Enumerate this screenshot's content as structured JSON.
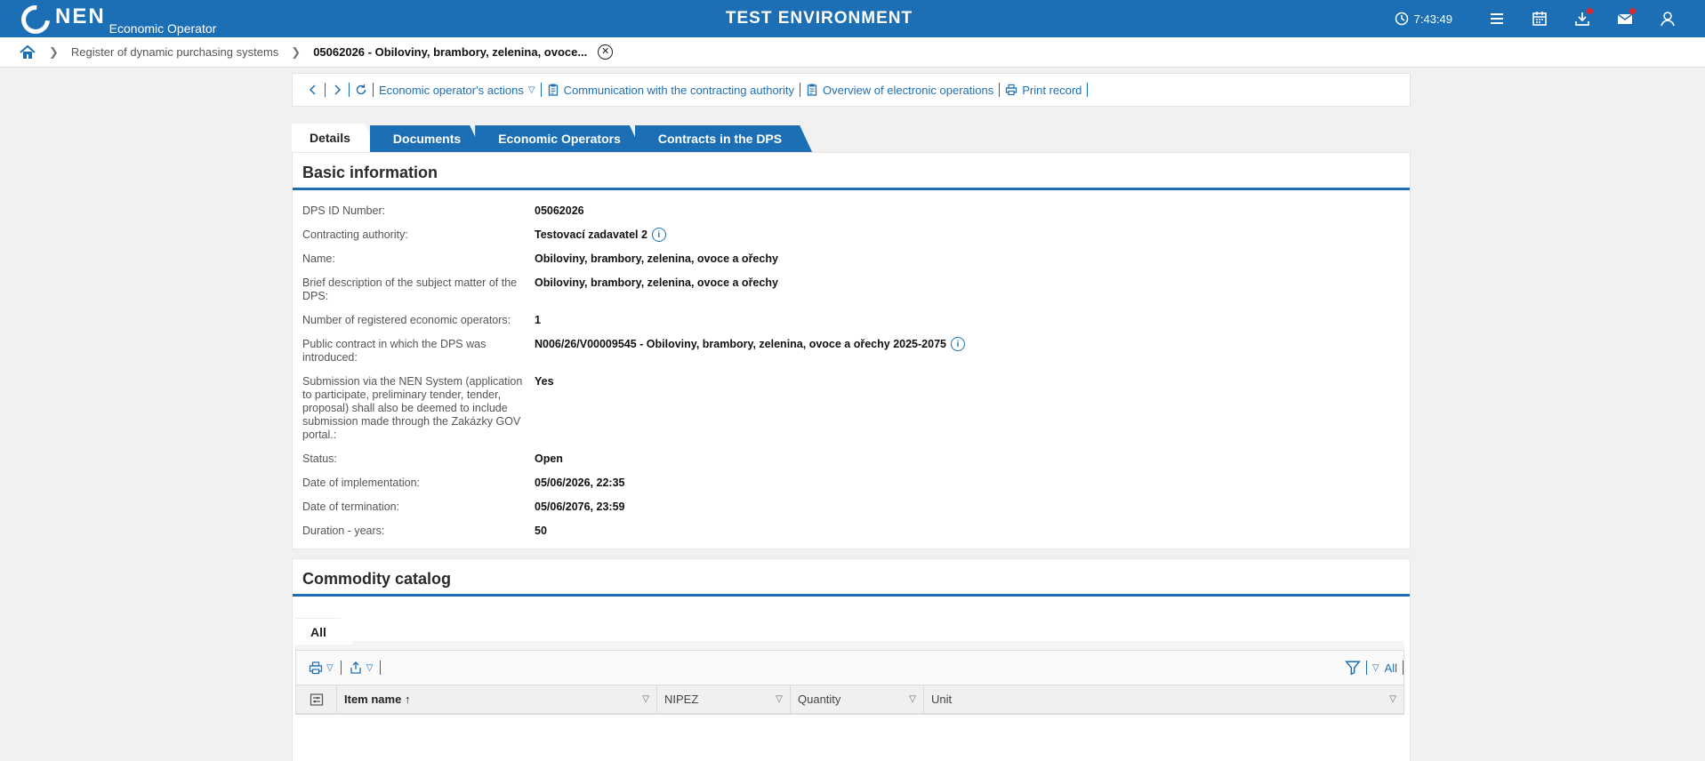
{
  "header": {
    "logo_text": "NEN",
    "logo_sub": "Economic Operator",
    "env_title": "TEST ENVIRONMENT",
    "clock": "7:43:49",
    "icons": [
      "clock-icon",
      "menu-icon",
      "calendar-icon",
      "download-icon",
      "mail-icon",
      "user-icon"
    ]
  },
  "breadcrumb": {
    "items": [
      "Register of dynamic purchasing systems"
    ],
    "current": "05062026 - Obiloviny, brambory, zelenina, ovoce..."
  },
  "toolbar": {
    "actions": "Economic operator's actions",
    "communication": "Communication with the contracting authority",
    "overview": "Overview of electronic operations",
    "print": "Print record"
  },
  "tabs": [
    "Details",
    "Documents",
    "Economic Operators",
    "Contracts in the DPS"
  ],
  "basic": {
    "title": "Basic information",
    "rows": [
      {
        "label": "DPS ID Number:",
        "value": "05062026"
      },
      {
        "label": "Contracting authority:",
        "value": "Testovací zadavatel 2"
      },
      {
        "label": "Name:",
        "value": "Obiloviny, brambory, zelenina, ovoce a ořechy"
      },
      {
        "label": "Brief description of the subject matter of the DPS:",
        "value": "Obiloviny, brambory, zelenina, ovoce a ořechy"
      },
      {
        "label": "Number of registered economic operators:",
        "value": "1"
      },
      {
        "label": "Public contract in which the DPS was introduced:",
        "value": "N006/26/V00009545 - Obiloviny, brambory, zelenina, ovoce a ořechy 2025-2075"
      },
      {
        "label": "Submission via the NEN System (application to participate, preliminary tender, tender, proposal) shall also be deemed to include submission made through the Zakázky GOV portal.:",
        "value": "Yes"
      },
      {
        "label": "Status:",
        "value": "Open"
      },
      {
        "label": "Date of implementation:",
        "value": "05/06/2026, 22:35"
      },
      {
        "label": "Date of termination:",
        "value": "05/06/2076, 23:59"
      },
      {
        "label": "Duration - years:",
        "value": "50"
      }
    ]
  },
  "catalog": {
    "title": "Commodity catalog",
    "subtab": "All",
    "filter_all": "All",
    "columns": [
      "Item name",
      "NIPEZ",
      "Quantity",
      "Unit"
    ]
  },
  "colors": {
    "brand": "#1d6fb5",
    "alert_dot": "#e3262d"
  }
}
